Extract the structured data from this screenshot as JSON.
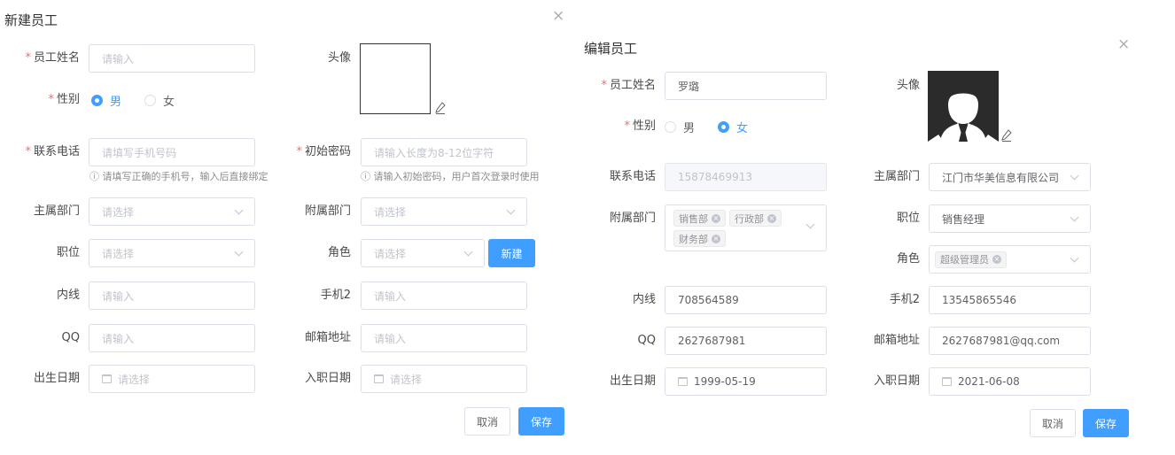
{
  "create": {
    "title": "新建员工",
    "close": "×",
    "name_label": "员工姓名",
    "name_placeholder": "请输入",
    "avatar_label": "头像",
    "gender_label": "性别",
    "gender_male": "男",
    "gender_female": "女",
    "gender_selected": "男",
    "phone_label": "联系电话",
    "phone_placeholder": "请填写手机号码",
    "phone_hint": "ⓘ 请填写正确的手机号，输入后直接绑定",
    "password_label": "初始密码",
    "password_placeholder": "请输入长度为8-12位字符",
    "password_hint": "ⓘ 请输入初始密码，用户首次登录时使用",
    "dept_label": "主属部门",
    "dept_placeholder": "请选择",
    "subdept_label": "附属部门",
    "subdept_placeholder": "请选择",
    "position_label": "职位",
    "position_placeholder": "请选择",
    "role_label": "角色",
    "role_placeholder": "请选择",
    "new_role_button": "新建",
    "ext_label": "内线",
    "ext_placeholder": "请输入",
    "phone2_label": "手机2",
    "phone2_placeholder": "请输入",
    "qq_label": "QQ",
    "qq_placeholder": "请输入",
    "email_label": "邮箱地址",
    "email_placeholder": "请输入",
    "birth_label": "出生日期",
    "birth_placeholder": "请选择",
    "hire_label": "入职日期",
    "hire_placeholder": "请选择",
    "cancel": "取消",
    "save": "保存"
  },
  "edit": {
    "title": "编辑员工",
    "close": "×",
    "name_label": "员工姓名",
    "name_value": "罗璐",
    "avatar_label": "头像",
    "gender_label": "性别",
    "gender_male": "男",
    "gender_female": "女",
    "gender_selected": "女",
    "phone_label": "联系电话",
    "phone_value": "15878469913",
    "dept_label": "主属部门",
    "dept_value": "江门市华美信息有限公司",
    "subdept_label": "附属部门",
    "subdept_tags": [
      "销售部",
      "行政部",
      "财务部"
    ],
    "position_label": "职位",
    "position_value": "销售经理",
    "role_label": "角色",
    "role_tags": [
      "超级管理员"
    ],
    "ext_label": "内线",
    "ext_value": "708564589",
    "phone2_label": "手机2",
    "phone2_value": "13545865546",
    "qq_label": "QQ",
    "qq_value": "2627687981",
    "email_label": "邮箱地址",
    "email_value": "2627687981@qq.com",
    "birth_label": "出生日期",
    "birth_value": "1999-05-19",
    "hire_label": "入职日期",
    "hire_value": "2021-06-08",
    "cancel": "取消",
    "save": "保存"
  },
  "icons": {
    "close": "close-icon",
    "pencil": "pencil-icon",
    "calendar": "calendar-icon",
    "chevron": "chevron-down-icon",
    "tag_remove": "tag-close-icon",
    "avatar": "avatar-silhouette-icon"
  },
  "colors": {
    "primary": "#409eff",
    "required": "#f56c6c",
    "border": "#dcdfe6",
    "placeholder": "#c0c4cc"
  }
}
